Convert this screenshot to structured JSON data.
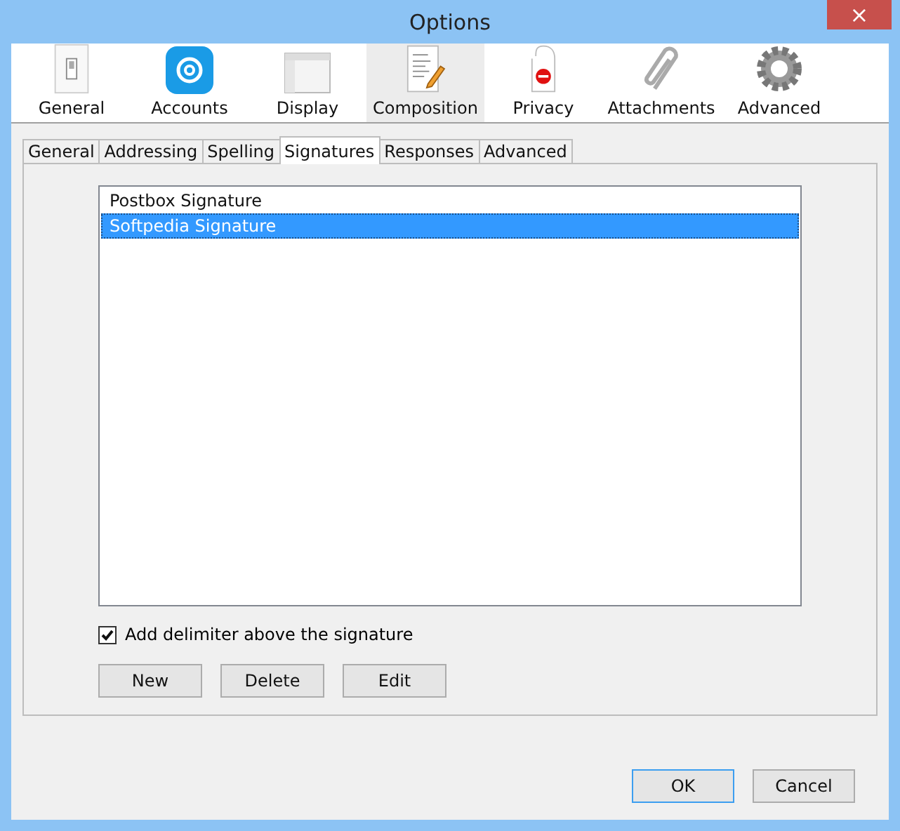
{
  "window": {
    "title": "Options",
    "close": "×"
  },
  "toolbar": [
    {
      "label": "General",
      "selected": false
    },
    {
      "label": "Accounts",
      "selected": false
    },
    {
      "label": "Display",
      "selected": false
    },
    {
      "label": "Composition",
      "selected": true
    },
    {
      "label": "Privacy",
      "selected": false
    },
    {
      "label": "Attachments",
      "selected": false
    },
    {
      "label": "Advanced",
      "selected": false
    }
  ],
  "tabs": [
    {
      "label": "General",
      "selected": false
    },
    {
      "label": "Addressing",
      "selected": false
    },
    {
      "label": "Spelling",
      "selected": false
    },
    {
      "label": "Signatures",
      "selected": true
    },
    {
      "label": "Responses",
      "selected": false
    },
    {
      "label": "Advanced",
      "selected": false
    }
  ],
  "signatures": [
    {
      "name": "Postbox Signature",
      "selected": false
    },
    {
      "name": "Softpedia Signature",
      "selected": true
    }
  ],
  "delimiter": {
    "label": "Add delimiter above the signature",
    "checked": true
  },
  "signature_buttons": [
    "New",
    "Delete",
    "Edit"
  ],
  "dialog_buttons": [
    {
      "label": "OK",
      "default": true
    },
    {
      "label": "Cancel",
      "default": false
    }
  ]
}
